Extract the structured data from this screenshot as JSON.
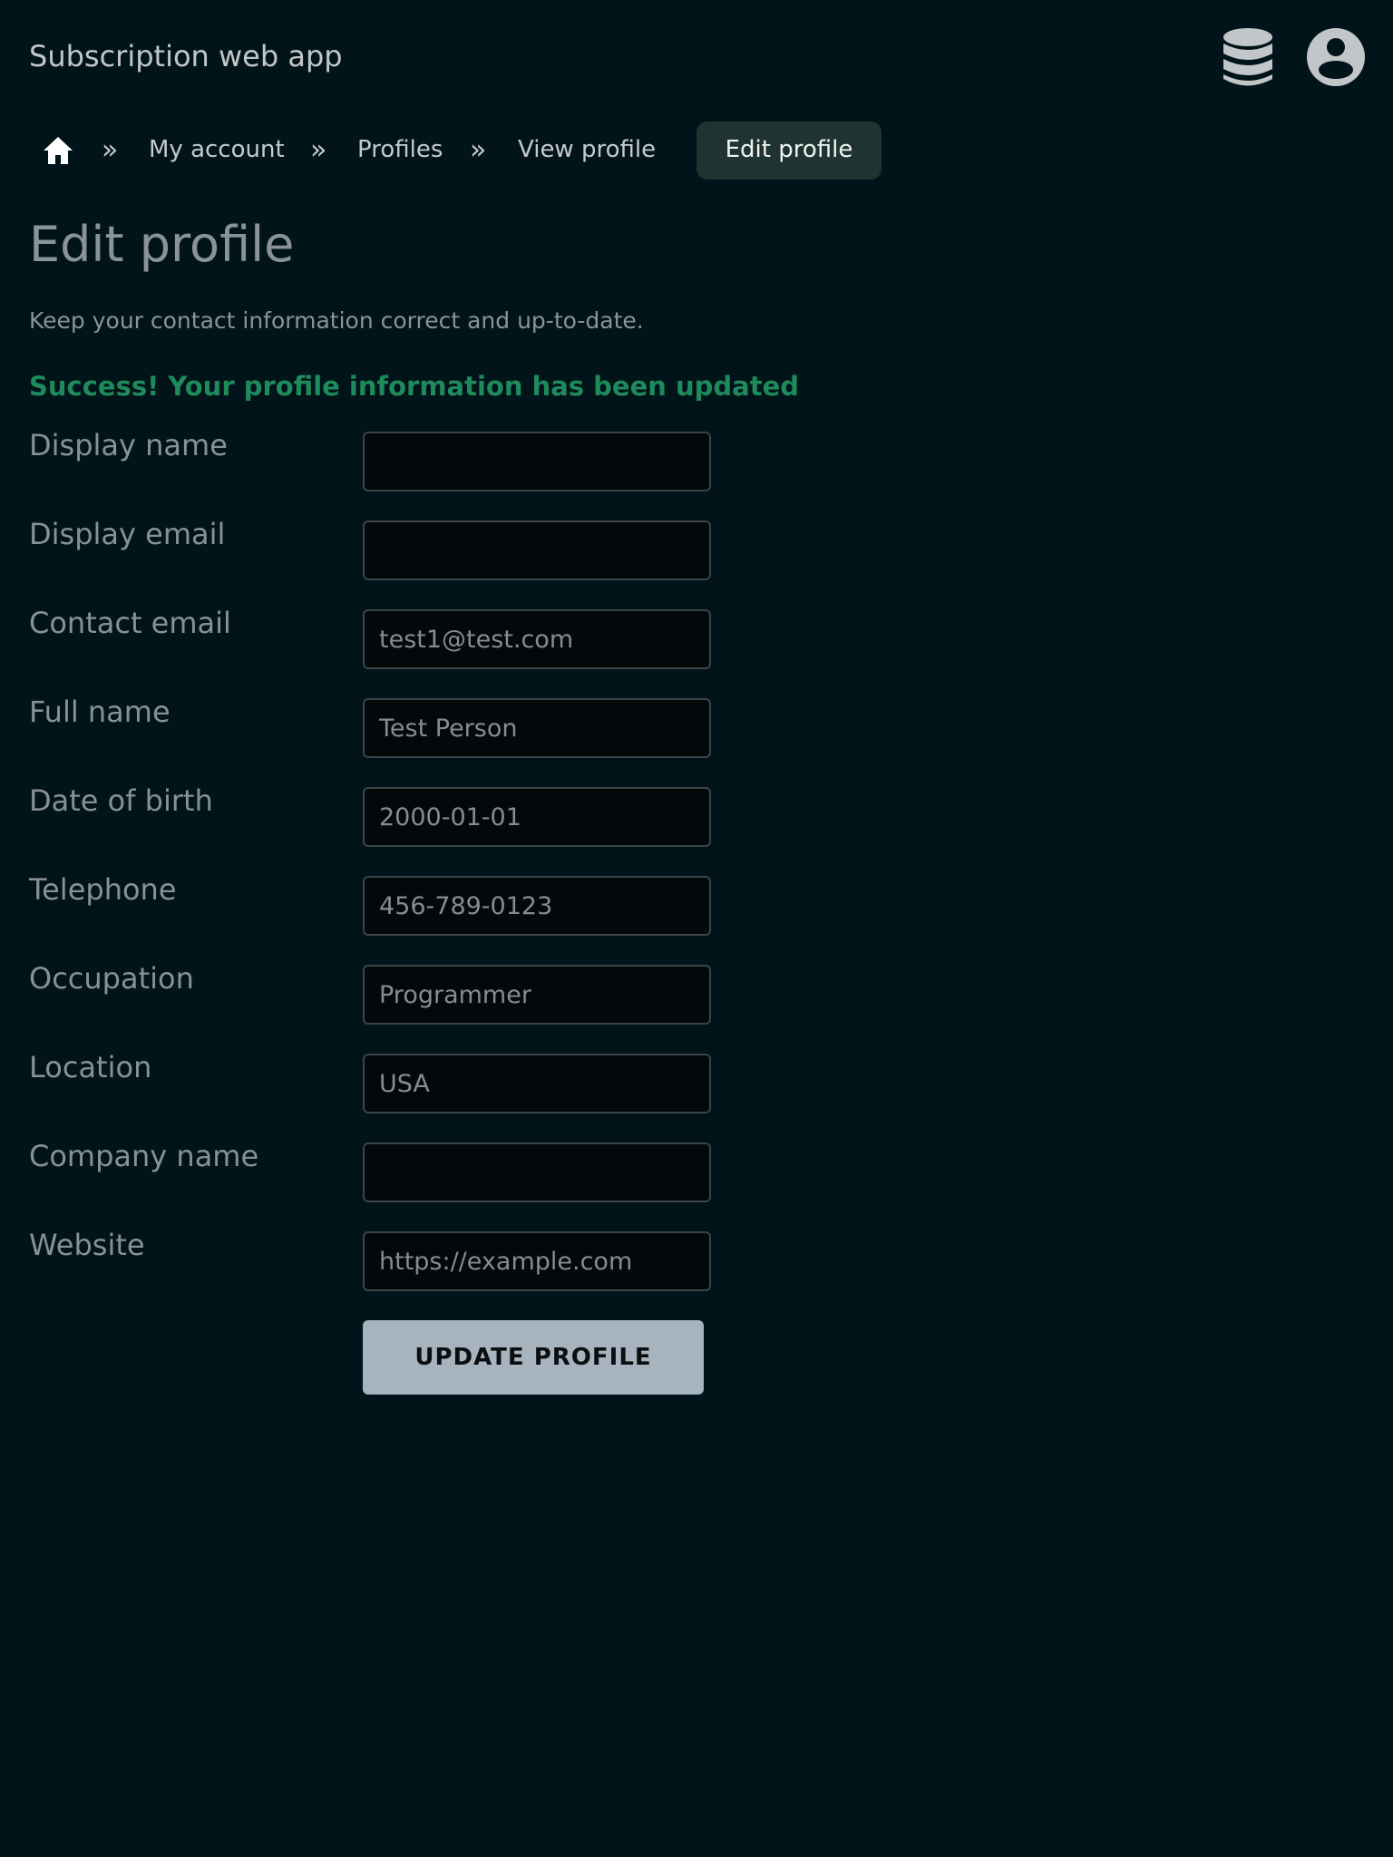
{
  "header": {
    "app_title": "Subscription web app",
    "icons": [
      "database-icon",
      "user-account-icon"
    ]
  },
  "breadcrumb": {
    "separator": "»",
    "items": [
      {
        "label": "My account"
      },
      {
        "label": "Profiles"
      },
      {
        "label": "View profile"
      }
    ],
    "current": "Edit profile"
  },
  "page": {
    "title": "Edit profile",
    "subtitle": "Keep your contact information correct and up-to-date.",
    "success_message": "Success! Your profile information has been updated"
  },
  "form": {
    "fields": [
      {
        "label": "Display name",
        "value": "",
        "placeholder": ""
      },
      {
        "label": "Display email",
        "value": "",
        "placeholder": ""
      },
      {
        "label": "Contact email",
        "value": "test1@test.com",
        "placeholder": ""
      },
      {
        "label": "Full name",
        "value": "Test Person",
        "placeholder": ""
      },
      {
        "label": "Date of birth",
        "value": "2000-01-01",
        "placeholder": ""
      },
      {
        "label": "Telephone",
        "value": "456-789-0123",
        "placeholder": ""
      },
      {
        "label": "Occupation",
        "value": "Programmer",
        "placeholder": ""
      },
      {
        "label": "Location",
        "value": "USA",
        "placeholder": ""
      },
      {
        "label": "Company name",
        "value": "",
        "placeholder": ""
      },
      {
        "label": "Website",
        "value": "",
        "placeholder": "https://example.com"
      }
    ],
    "submit_label": "UPDATE PROFILE"
  },
  "colors": {
    "background": "#00141a",
    "success": "#1f8a5c",
    "button": "#a7b3bf",
    "breadcrumb_active": "#1f3430"
  }
}
